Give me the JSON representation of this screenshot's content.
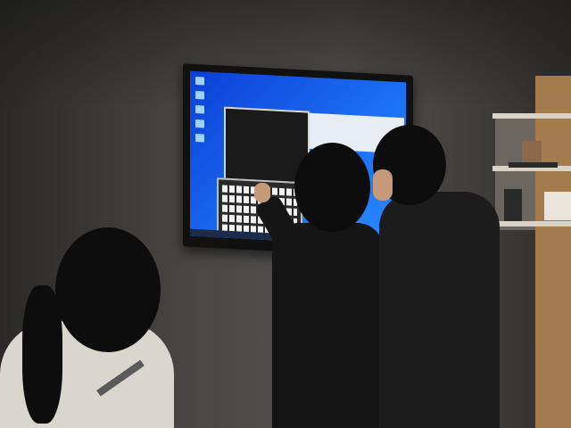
{
  "scene": {
    "description_items": [
      "wall-mounted-touchscreen",
      "windows-desktop",
      "command-prompt-window",
      "on-screen-keyboard",
      "three-visitors",
      "wooden-shelf"
    ],
    "colors": {
      "wall": "#4a4845",
      "screen_blue": "#1b6df2",
      "monitor_bezel": "#111111",
      "jacket_black": "#151515",
      "jacket_white": "#d9d5cf",
      "shelf_wood": "#a37b4d"
    }
  }
}
